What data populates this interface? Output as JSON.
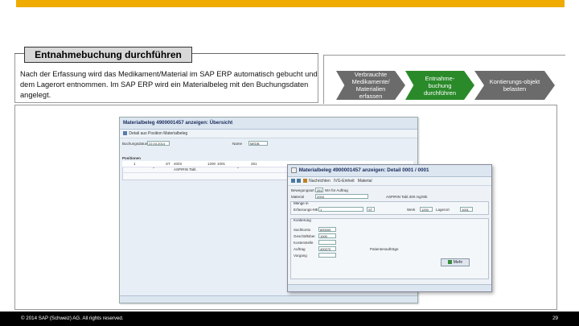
{
  "slide": {
    "title": "Entnahmebuchung durchführen",
    "description": "Nach der Erfassung wird das Medikament/Material im SAP ERP automatisch gebucht und dem Lagerort entnommen. Im SAP ERP wird ein Materialbeleg mit den Buchungsdaten angelegt.",
    "steps": [
      "Verbrauchte Medikamente/ Materialien erfassen",
      "Entnahme-buchung durchführen",
      "Kontierungs-objekt belasten"
    ],
    "active_step": 1,
    "colors": {
      "accent": "#f0ab00",
      "active": "#2a8a2a",
      "inactive": "#6b6b6b"
    }
  },
  "sap_overview": {
    "title": "Materialbeleg 4900001457 anzeigen: Übersicht",
    "toolbar": "Detail aus Position   Materialbeleg",
    "header_fields": [
      {
        "label": "Buchungsdatum",
        "value": "22.03.2014"
      },
      {
        "label": "Name",
        "value": "MEDB"
      }
    ],
    "section_label": "Positionen",
    "columns": [
      "Pos",
      "Menge in EME",
      "EME",
      "Material",
      "Werk",
      "LOrt",
      "Charge",
      "BS",
      "KL",
      "S"
    ],
    "rows": [
      [
        "1",
        "",
        "ST",
        "2003",
        "1200",
        "1001",
        "",
        "261",
        "",
        ""
      ],
      [
        "",
        "",
        "",
        "ASPIRIN Tabl.",
        "",
        "",
        "",
        "",
        "",
        ""
      ]
    ]
  },
  "sap_detail": {
    "title": "Materialbeleg 4900001457 anzeigen: Detail 0001 / 0001",
    "toolbar_items": [
      "Nachrichten",
      "IVG-Einheit",
      "Material"
    ],
    "bewegungsart_label": "Bewegungsart",
    "bewegungsart": "261",
    "bewegungsart_text": "WA für Auftrag",
    "material_label": "Material",
    "material": "2003",
    "material_text": "ASPIRIN Tabl.300 mg/Stk",
    "menge_group_label": "Menge in",
    "menge_label": "Erfassungs-ME",
    "menge": "1",
    "me": "ST",
    "werk_label": "Werk",
    "werk": "1200",
    "lagerort_label": "Lagerort",
    "lagerort": "1001",
    "kont_group_label": "Kontierung",
    "kont_fields": [
      {
        "label": "Sachkonto",
        "value": "890000"
      },
      {
        "label": "Geschäftsber.",
        "value": "1000"
      },
      {
        "label": "Kostenstelle",
        "value": ""
      },
      {
        "label": "Auftrag",
        "value": "400270"
      },
      {
        "label": "Vorgang",
        "value": ""
      }
    ],
    "auftrag_text": "Patientenaufträge",
    "more_button": "Mehr"
  },
  "footer": {
    "copyright": "© 2014 SAP (Schweiz) AG. All rights reserved.",
    "page_number": "29"
  }
}
